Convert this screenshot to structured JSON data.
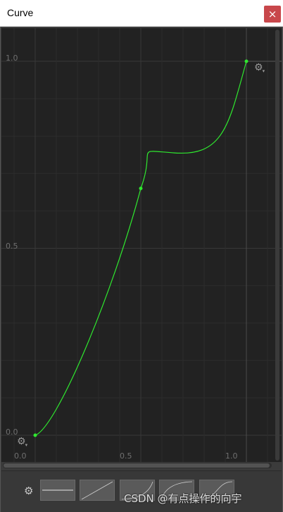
{
  "window": {
    "title": "Curve",
    "close_label": "×"
  },
  "axes": {
    "y_labels": [
      "1.0",
      "0.5",
      "0.0"
    ],
    "x_labels": [
      "0.0",
      "0.5",
      "1.0"
    ]
  },
  "curve": {
    "color": "#2fe82f",
    "keys": [
      {
        "time": 0.0,
        "value": 0.0
      },
      {
        "time": 0.5,
        "value": 0.66
      },
      {
        "time": 1.0,
        "value": 1.0
      }
    ]
  },
  "icons": {
    "key_settings": "gear-icon",
    "presets_settings": "gear-icon"
  },
  "presets": [
    {
      "name": "constant"
    },
    {
      "name": "linear"
    },
    {
      "name": "ease-in"
    },
    {
      "name": "ease-out"
    },
    {
      "name": "ease-in-out"
    }
  ],
  "watermark": "CSDN @有点操作的向宇"
}
